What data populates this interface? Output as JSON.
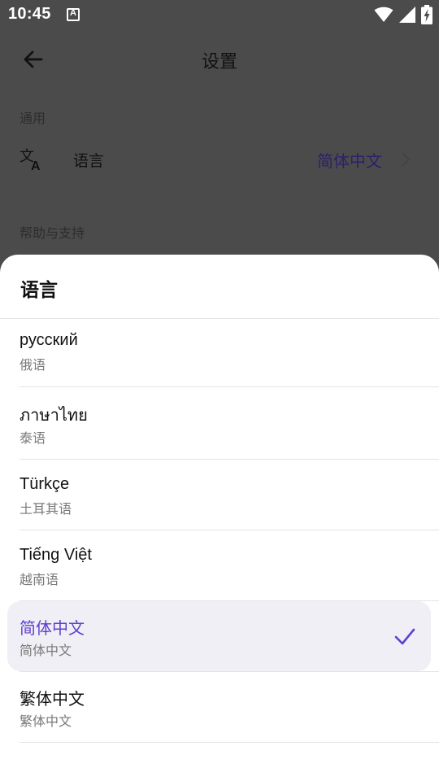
{
  "status_bar": {
    "time": "10:45",
    "notification_icon": "a-icon",
    "icons": [
      "wifi-icon",
      "signal-icon",
      "battery-charging-icon"
    ]
  },
  "settings": {
    "title": "设置",
    "back_icon": "arrow-left-icon",
    "sections": [
      {
        "label": "通用",
        "items": [
          {
            "icon": "translate-icon",
            "label": "语言",
            "value": "简体中文"
          }
        ]
      },
      {
        "label": "帮助与支持"
      }
    ]
  },
  "language_sheet": {
    "title": "语言",
    "options": [
      {
        "name": "русский",
        "subtitle": "俄语",
        "selected": false
      },
      {
        "name": "ภาษาไทย",
        "subtitle": "泰语",
        "selected": false
      },
      {
        "name": "Türkçe",
        "subtitle": "土耳其语",
        "selected": false
      },
      {
        "name": "Tiếng Việt",
        "subtitle": "越南语",
        "selected": false
      },
      {
        "name": "简体中文",
        "subtitle": "简体中文",
        "selected": true
      },
      {
        "name": "繁体中文",
        "subtitle": "繁体中文",
        "selected": false
      }
    ]
  },
  "colors": {
    "accent": "#5f3fd1",
    "value_text": "#2a226a",
    "selected_bg": "#f0eff5",
    "scrim": "#4b4b4b"
  }
}
